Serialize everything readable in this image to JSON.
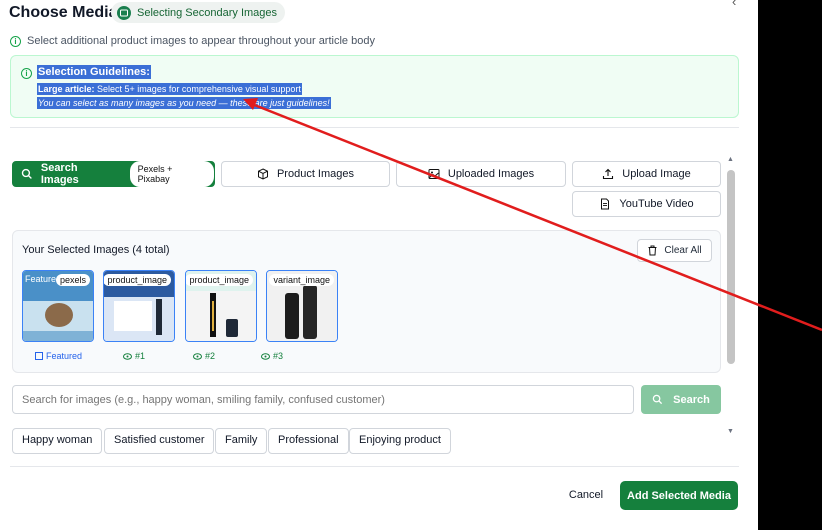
{
  "modal": {
    "title": "Choose Media",
    "status_pill": "Selecting Secondary Images",
    "subtitle": "Select additional product images to appear throughout your article body"
  },
  "guidelines": {
    "title": "Selection Guidelines:",
    "line1_bold": "Large article:",
    "line1_text": " Select 5+ images for comprehensive visual support",
    "line2": "You can select as many images as you need — these are just guidelines!"
  },
  "tabs": {
    "search_label": "Search Images",
    "search_badge": "Pexels + Pixabay",
    "product_label": "Product Images",
    "uploaded_label": "Uploaded Images",
    "upload_label": "Upload Image",
    "youtube_label": "YouTube Video"
  },
  "selected": {
    "title": "Your Selected Images (4 total)",
    "clear_all": "Clear All",
    "items": [
      {
        "label": "pexels",
        "featured_overlay": "Featured",
        "caption": "Featured",
        "colors": [
          "#4a90c8",
          "#c9e1ef",
          "#8b6a4a"
        ]
      },
      {
        "label": "product_image",
        "caption": "#1",
        "colors": [
          "#2c5aa0",
          "#dbe6f5",
          "#1f2937"
        ]
      },
      {
        "label": "product_image",
        "caption": "#2",
        "colors": [
          "#dff3ee",
          "#f4f4f4",
          "#111111"
        ]
      },
      {
        "label": "variant_image",
        "caption": "#3",
        "colors": [
          "#ffffff",
          "#f1f1f1",
          "#1d1d1d"
        ]
      }
    ]
  },
  "search": {
    "placeholder": "Search for images (e.g., happy woman, smiling family, confused customer)",
    "button_label": "Search"
  },
  "chips": [
    "Happy woman",
    "Satisfied customer",
    "Family",
    "Professional",
    "Enjoying product"
  ],
  "footer": {
    "cancel_label": "Cancel",
    "add_label": "Add Selected Media"
  },
  "colors": {
    "primary_green": "#15803d",
    "selection_blue": "#3b6fd6",
    "annotation_red": "#e11d1d"
  }
}
